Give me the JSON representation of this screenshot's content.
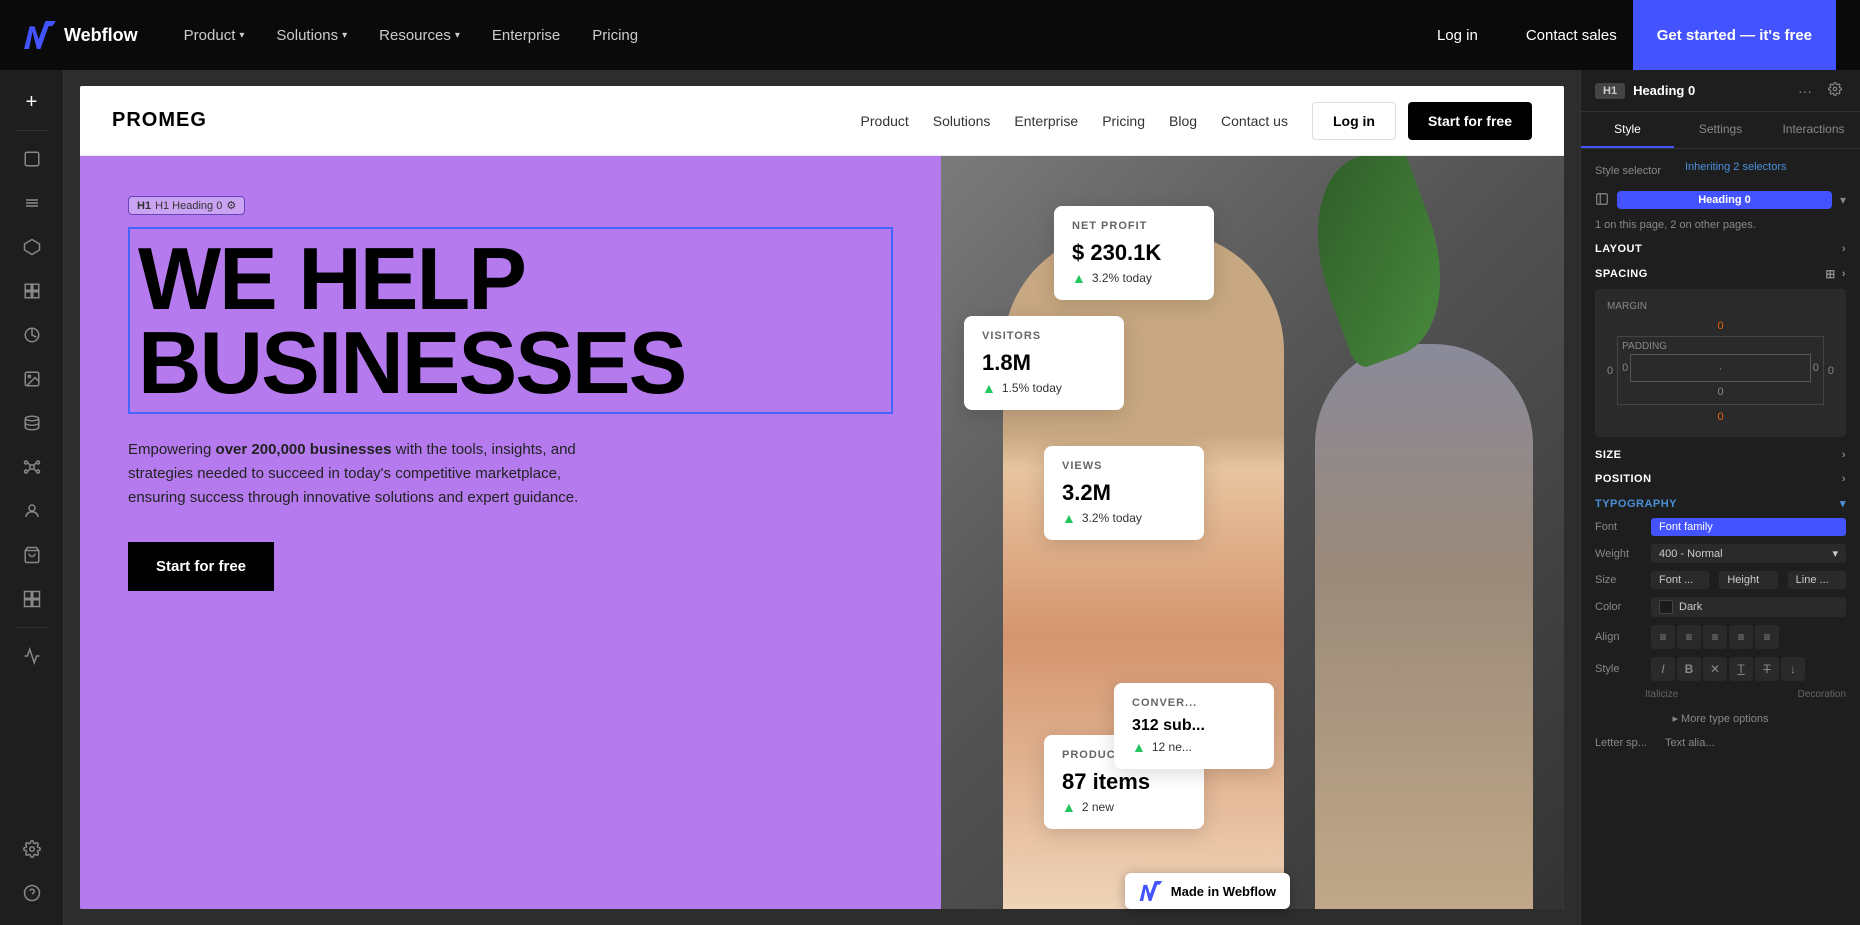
{
  "topNav": {
    "logo_text": "Webflow",
    "links": [
      {
        "label": "Product",
        "hasChevron": true
      },
      {
        "label": "Solutions",
        "hasChevron": true
      },
      {
        "label": "Resources",
        "hasChevron": true
      },
      {
        "label": "Enterprise",
        "hasChevron": false
      },
      {
        "label": "Pricing",
        "hasChevron": false
      }
    ],
    "login_label": "Log in",
    "contact_label": "Contact sales",
    "cta_label": "Get started — it's free"
  },
  "leftSidebar": {
    "icons": [
      {
        "name": "add-icon",
        "symbol": "+"
      },
      {
        "name": "page-icon",
        "symbol": "⬜"
      },
      {
        "name": "menu-icon",
        "symbol": "≡"
      },
      {
        "name": "components-icon",
        "symbol": "⬡"
      },
      {
        "name": "assets-icon",
        "symbol": "◇"
      },
      {
        "name": "paint-icon",
        "symbol": "💧"
      },
      {
        "name": "image-icon",
        "symbol": "🖼"
      },
      {
        "name": "database-icon",
        "symbol": "⬛"
      },
      {
        "name": "nodes-icon",
        "symbol": "⚙"
      },
      {
        "name": "person-icon",
        "symbol": "👤"
      },
      {
        "name": "bag-icon",
        "symbol": "🛍"
      },
      {
        "name": "grid-icon",
        "symbol": "⊞"
      },
      {
        "name": "activity-icon",
        "symbol": "📈"
      }
    ],
    "bottom_icons": [
      {
        "name": "settings-icon",
        "symbol": "⚙"
      },
      {
        "name": "help-icon",
        "symbol": "?"
      }
    ]
  },
  "previewNav": {
    "logo": "PROMEG",
    "links": [
      "Product",
      "Solutions",
      "Enterprise",
      "Pricing",
      "Blog",
      "Contact us"
    ],
    "login_label": "Log in",
    "cta_label": "Start for free"
  },
  "hero": {
    "label": "H1 Heading 0",
    "heading_line1": "WE HELP",
    "heading_line2": "BUSINESSES",
    "subtext_prefix": "Empowering ",
    "subtext_bold": "over 200,000 businesses",
    "subtext_suffix": " with the tools, insights, and strategies needed to succeed in today's competitive marketplace, ensuring success through innovative solutions and expert guidance.",
    "cta_label": "Start for free"
  },
  "stats": {
    "net_profit": {
      "label": "NET PROFIT",
      "value": "$ 230.1K",
      "change": "3.2% today"
    },
    "visitors": {
      "label": "VISITORS",
      "value": "1.8M",
      "change": "1.5% today"
    },
    "views": {
      "label": "VIEWS",
      "value": "3.2M",
      "change": "3.2% today"
    },
    "products": {
      "label": "PRODUCTS",
      "value": "87 items",
      "change": "2 new"
    },
    "conversions": {
      "label": "CONVER...",
      "value": "312 sub...",
      "change": "12 ne..."
    }
  },
  "rightPanel": {
    "element_badge": "H1",
    "element_title": "Heading 0",
    "tabs": [
      "Style",
      "Settings",
      "Interactions"
    ],
    "style_selector_label": "Style selector",
    "inheriting_label": "Inheriting 2 selectors",
    "selector_name": "Heading 0",
    "count_text": "1 on this page, 2 on other pages.",
    "sections": {
      "layout": "Layout",
      "spacing": "Spacing",
      "size": "Size",
      "position": "Position",
      "typography": "Typography"
    },
    "spacing": {
      "margin_label": "MARGIN",
      "padding_label": "PADDING",
      "margin_top": "0",
      "margin_right": "0",
      "margin_bottom": "0",
      "margin_left": "0",
      "padding_top": "0",
      "padding_right": "0",
      "padding_bottom": "0",
      "padding_left": "0",
      "orange_value": "0"
    },
    "typography": {
      "font_label": "Font",
      "font_value": "Font family",
      "weight_label": "Weight",
      "weight_value": "400 - Normal",
      "size_label": "Size",
      "size_btn": "Font ...",
      "height_btn": "Height",
      "line_btn": "Line ...",
      "color_label": "Color",
      "color_value": "Dark",
      "align_label": "Align",
      "style_label": "Style",
      "style_btns": [
        "I",
        "B",
        "✕",
        "T̲",
        "T̶",
        "↓"
      ],
      "italicize": "Italicize",
      "decoration": "Decoration",
      "more_options": "▸ More type options",
      "letter_spacing_label": "Letter sp...",
      "letter_spacing_value": "Text alia..."
    }
  },
  "webflowBadge": {
    "text": "Made in Webflow"
  }
}
